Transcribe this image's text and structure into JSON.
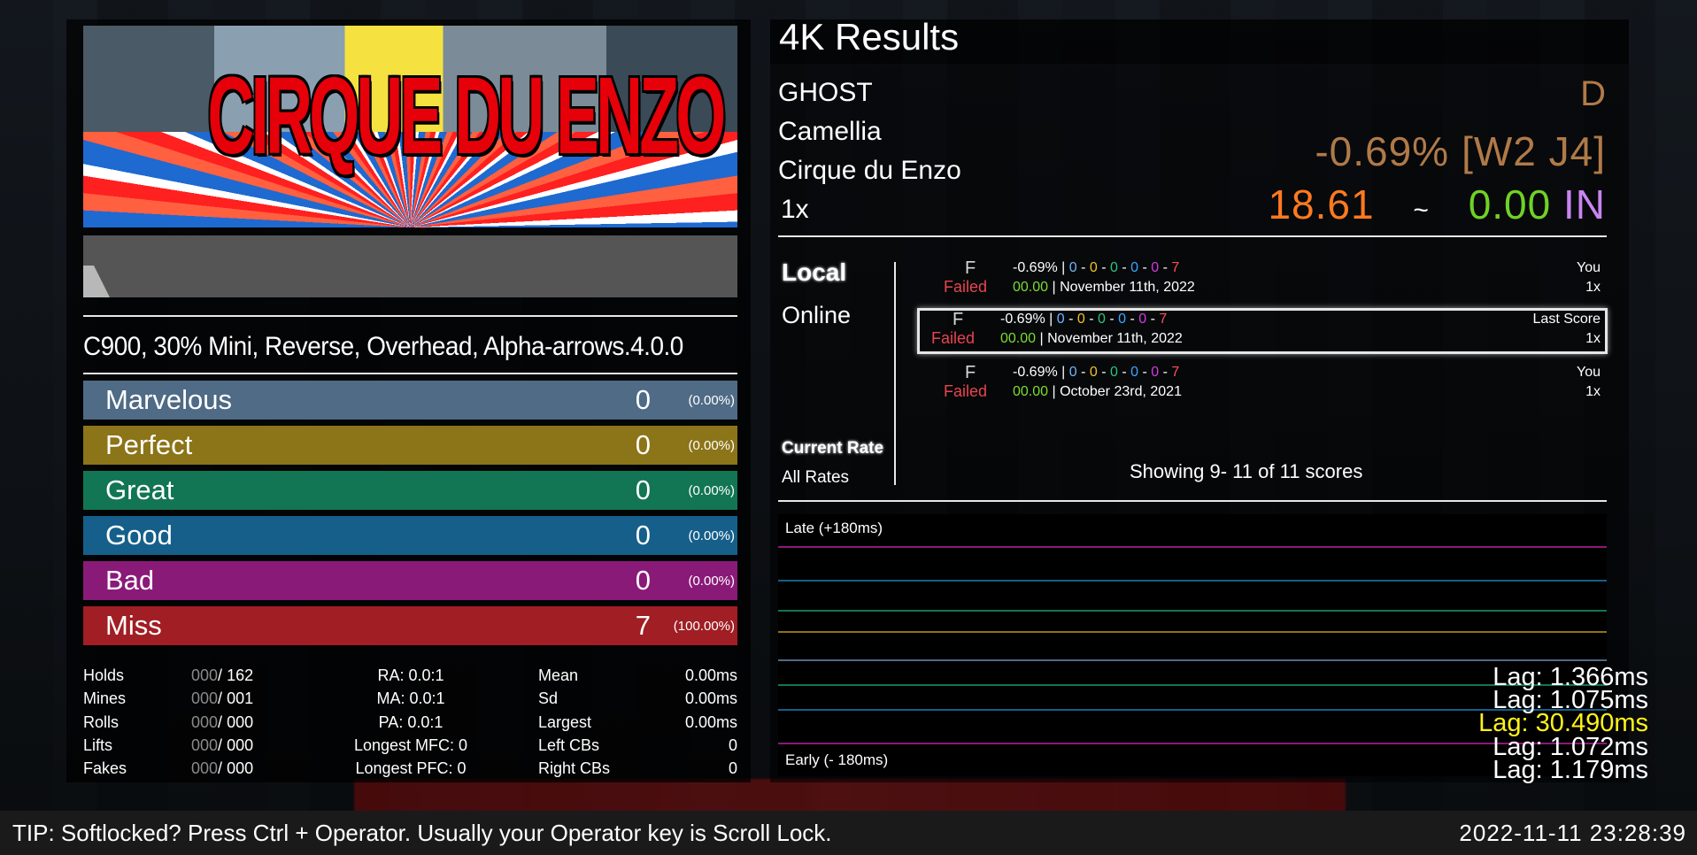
{
  "banner": {
    "logo_text": "CIRQUE DU ENZO"
  },
  "modifiers": "C900, 30% Mini, Reverse, Overhead, Alpha-arrows.4.0.0",
  "judgments": [
    {
      "name": "Marvelous",
      "count": "0",
      "pct": "(0.00%)",
      "color": "#4f6b85"
    },
    {
      "name": "Perfect",
      "count": "0",
      "pct": "(0.00%)",
      "color": "#8c7418"
    },
    {
      "name": "Great",
      "count": "0",
      "pct": "(0.00%)",
      "color": "#127553"
    },
    {
      "name": "Good",
      "count": "0",
      "pct": "(0.00%)",
      "color": "#155f8a"
    },
    {
      "name": "Bad",
      "count": "0",
      "pct": "(0.00%)",
      "color": "#8a1a78"
    },
    {
      "name": "Miss",
      "count": "7",
      "pct": "(100.00%)",
      "color": "#a01e24"
    }
  ],
  "stats_left": [
    {
      "label": "Holds",
      "hit": "000",
      "total": "162"
    },
    {
      "label": "Mines",
      "hit": "000",
      "total": "001"
    },
    {
      "label": "Rolls",
      "hit": "000",
      "total": "000"
    },
    {
      "label": "Lifts",
      "hit": "000",
      "total": "000"
    },
    {
      "label": "Fakes",
      "hit": "000",
      "total": "000"
    }
  ],
  "stats_mid": [
    "RA: 0.0:1",
    "MA: 0.0:1",
    "PA: 0.0:1",
    "Longest MFC: 0",
    "Longest PFC: 0"
  ],
  "stats_right": [
    {
      "label": "Mean",
      "value": "0.00ms"
    },
    {
      "label": "Sd",
      "value": "0.00ms"
    },
    {
      "label": "Largest",
      "value": "0.00ms"
    },
    {
      "label": "Left CBs",
      "value": "0"
    },
    {
      "label": "Right CBs",
      "value": "0"
    }
  ],
  "results": {
    "title": "4K Results",
    "player": "GHOST",
    "artist": "Camellia",
    "song": "Cirque du Enzo",
    "rate": "1x",
    "grade": "D",
    "score": "-0.69%",
    "judge": "[W2 J4]",
    "msd": "18.61",
    "tilde": "~",
    "ssr": "0.00",
    "skillset": "IN"
  },
  "tabs": {
    "local": "Local",
    "online": "Online",
    "current_rate": "Current Rate",
    "all_rates": "All Rates"
  },
  "scores": [
    {
      "grade": "F",
      "status": "Failed",
      "pct": "-0.69%",
      "j": [
        "0",
        "0",
        "0",
        "0",
        "0",
        "7"
      ],
      "ssr": "00.00",
      "date": "November 11th, 2022",
      "who": "You",
      "rate": "1x"
    },
    {
      "grade": "F",
      "status": "Failed",
      "pct": "-0.69%",
      "j": [
        "0",
        "0",
        "0",
        "0",
        "0",
        "7"
      ],
      "ssr": "00.00",
      "date": "November 11th, 2022",
      "who": "Last Score",
      "rate": "1x"
    },
    {
      "grade": "F",
      "status": "Failed",
      "pct": "-0.69%",
      "j": [
        "0",
        "0",
        "0",
        "0",
        "0",
        "7"
      ],
      "ssr": "00.00",
      "date": "October 23rd, 2021",
      "who": "You",
      "rate": "1x"
    }
  ],
  "showing": "Showing 9- 11 of 11 scores",
  "offset_plot": {
    "late_label": "Late (+180ms)",
    "early_label": "Early (- 180ms)",
    "line_colors": [
      "#8a1a78",
      "#155f8a",
      "#127553",
      "#8c7418",
      "#4f6b85",
      "#127553",
      "#155f8a",
      "#8a1a78"
    ]
  },
  "lag": [
    {
      "text": "Lag: 1.366ms",
      "color": "#ffffff"
    },
    {
      "text": "Lag: 1.075ms",
      "color": "#ffffff"
    },
    {
      "text": "Lag: 30.490ms",
      "color": "#fff21a"
    },
    {
      "text": "Lag: 1.072ms",
      "color": "#ffffff"
    },
    {
      "text": "Lag: 1.179ms",
      "color": "#ffffff"
    }
  ],
  "tip": "TIP: Softlocked? Press Ctrl + Operator. Usually your Operator key is Scroll Lock.",
  "clock": "2022-11-11 23:28:39"
}
